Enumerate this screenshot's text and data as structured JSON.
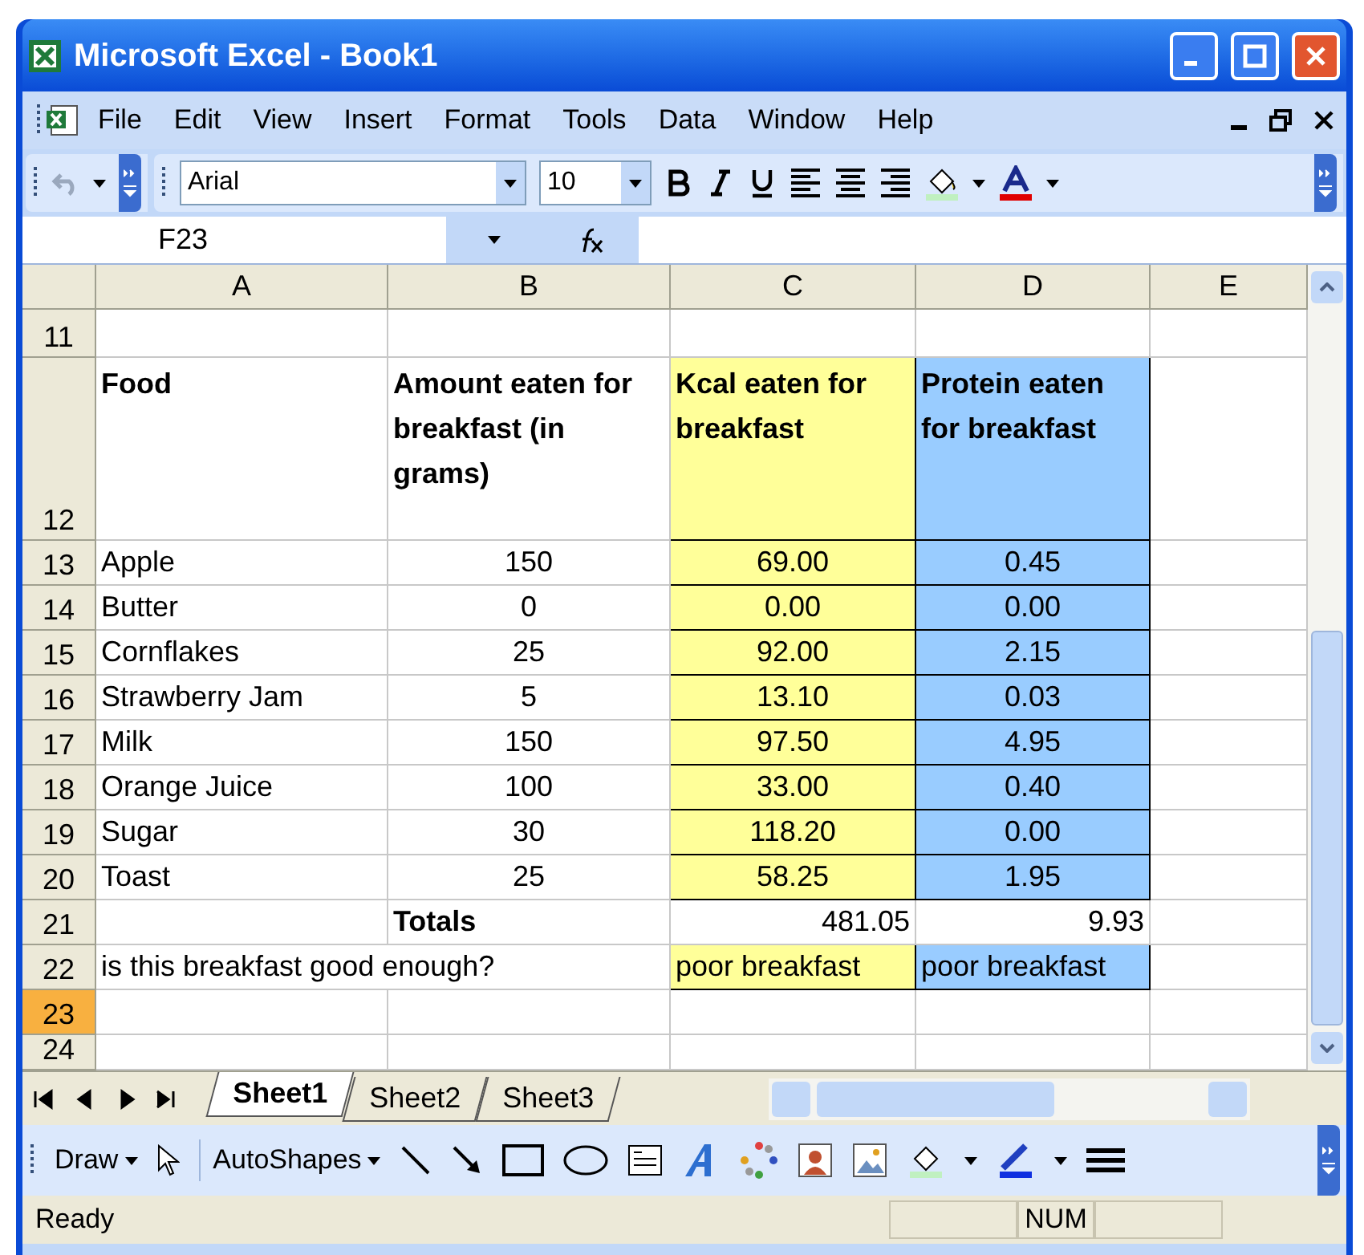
{
  "window": {
    "title": "Microsoft Excel - Book1"
  },
  "menu": [
    "File",
    "Edit",
    "View",
    "Insert",
    "Format",
    "Tools",
    "Data",
    "Window",
    "Help"
  ],
  "formatting_toolbar": {
    "font": "Arial",
    "size": "10"
  },
  "name_box": "F23",
  "columns": [
    "A",
    "B",
    "C",
    "D",
    "E"
  ],
  "rows": [
    {
      "number": "11",
      "selected": false,
      "kind": "blank",
      "cells": [
        null,
        null,
        null,
        null,
        null
      ]
    },
    {
      "number": "12",
      "selected": false,
      "kind": "header",
      "cells": [
        {
          "text": "Food"
        },
        {
          "text": "Amount eaten for breakfast (in grams)"
        },
        {
          "text": "Kcal eaten for breakfast",
          "color": "#ffff99"
        },
        {
          "text": "Protein eaten for breakfast",
          "color": "#99ccff"
        },
        null
      ]
    },
    {
      "number": "13",
      "selected": false,
      "kind": "item",
      "cells": [
        {
          "text": "Apple"
        },
        {
          "text": "150"
        },
        {
          "text": "69.00",
          "color": "#ffff99"
        },
        {
          "text": "0.45",
          "color": "#99ccff"
        },
        null
      ]
    },
    {
      "number": "14",
      "selected": false,
      "kind": "item",
      "cells": [
        {
          "text": "Butter"
        },
        {
          "text": "0"
        },
        {
          "text": "0.00",
          "color": "#ffff99"
        },
        {
          "text": "0.00",
          "color": "#99ccff"
        },
        null
      ]
    },
    {
      "number": "15",
      "selected": false,
      "kind": "item",
      "cells": [
        {
          "text": "Cornflakes"
        },
        {
          "text": "25"
        },
        {
          "text": "92.00",
          "color": "#ffff99"
        },
        {
          "text": "2.15",
          "color": "#99ccff"
        },
        null
      ]
    },
    {
      "number": "16",
      "selected": false,
      "kind": "item",
      "cells": [
        {
          "text": "Strawberry Jam"
        },
        {
          "text": "5"
        },
        {
          "text": "13.10",
          "color": "#ffff99"
        },
        {
          "text": "0.03",
          "color": "#99ccff"
        },
        null
      ]
    },
    {
      "number": "17",
      "selected": false,
      "kind": "item",
      "cells": [
        {
          "text": "Milk"
        },
        {
          "text": "150"
        },
        {
          "text": "97.50",
          "color": "#ffff99"
        },
        {
          "text": "4.95",
          "color": "#99ccff"
        },
        null
      ]
    },
    {
      "number": "18",
      "selected": false,
      "kind": "item",
      "cells": [
        {
          "text": "Orange Juice"
        },
        {
          "text": "100"
        },
        {
          "text": "33.00",
          "color": "#ffff99"
        },
        {
          "text": "0.40",
          "color": "#99ccff"
        },
        null
      ]
    },
    {
      "number": "19",
      "selected": false,
      "kind": "item",
      "cells": [
        {
          "text": "Sugar"
        },
        {
          "text": "30"
        },
        {
          "text": "118.20",
          "color": "#ffff99"
        },
        {
          "text": "0.00",
          "color": "#99ccff"
        },
        null
      ]
    },
    {
      "number": "20",
      "selected": false,
      "kind": "item",
      "cells": [
        {
          "text": "Toast"
        },
        {
          "text": "25"
        },
        {
          "text": "58.25",
          "color": "#ffff99"
        },
        {
          "text": "1.95",
          "color": "#99ccff"
        },
        null
      ]
    },
    {
      "number": "21",
      "selected": false,
      "kind": "totals",
      "cells": [
        null,
        {
          "text": "Totals"
        },
        {
          "text": "481.05"
        },
        {
          "text": "9.93"
        },
        null
      ]
    },
    {
      "number": "22",
      "selected": false,
      "kind": "verdict",
      "cells": [
        {
          "text": "is this breakfast good enough?"
        },
        null,
        {
          "text": "poor breakfast",
          "color": "#ffff99"
        },
        {
          "text": "poor breakfast",
          "color": "#99ccff"
        },
        null
      ]
    },
    {
      "number": "23",
      "selected": true,
      "kind": "blank",
      "cells": [
        null,
        null,
        null,
        null,
        null
      ]
    },
    {
      "number": "24",
      "selected": false,
      "kind": "blank",
      "cells": [
        null,
        null,
        null,
        null,
        null
      ]
    }
  ],
  "sheet_tabs": [
    {
      "label": "Sheet1",
      "selected": true
    },
    {
      "label": "Sheet2",
      "selected": false
    },
    {
      "label": "Sheet3",
      "selected": false
    }
  ],
  "drawing_toolbar": {
    "draw": "Draw",
    "autoshapes": "AutoShapes"
  },
  "status_bar": {
    "status": "Ready",
    "num": "NUM"
  }
}
